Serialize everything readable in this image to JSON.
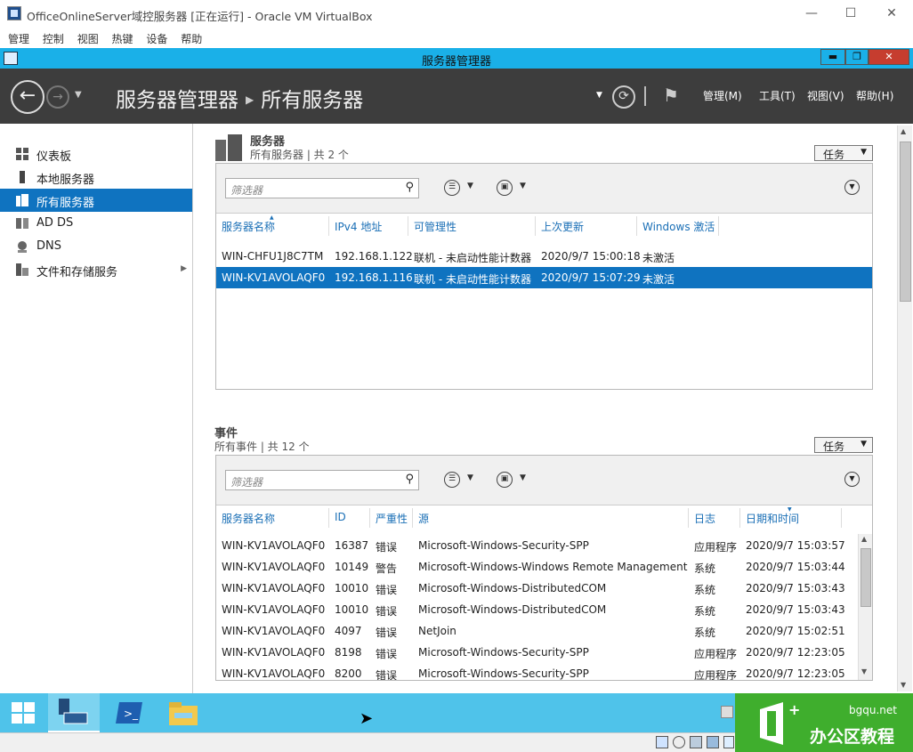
{
  "vbox": {
    "title": "OfficeOnlineServer域控服务器 [正在运行] - Oracle VM VirtualBox",
    "menu": [
      "管理",
      "控制",
      "视图",
      "热键",
      "设备",
      "帮助"
    ]
  },
  "guest_title": "服务器管理器",
  "header": {
    "app": "服务器管理器",
    "page": "所有服务器",
    "menus": [
      "管理(M)",
      "工具(T)",
      "视图(V)",
      "帮助(H)"
    ]
  },
  "nav": {
    "items": [
      {
        "label": "仪表板",
        "icon": "dashboard-icon"
      },
      {
        "label": "本地服务器",
        "icon": "server-icon"
      },
      {
        "label": "所有服务器",
        "icon": "servers-icon",
        "selected": true
      },
      {
        "label": "AD DS",
        "icon": "ad-ds-icon"
      },
      {
        "label": "DNS",
        "icon": "dns-icon"
      },
      {
        "label": "文件和存储服务",
        "icon": "storage-icon",
        "has_arrow": true
      }
    ]
  },
  "servers": {
    "title": "服务器",
    "subtitle": "所有服务器 | 共 2 个",
    "task_label": "任务",
    "filter_placeholder": "筛选器",
    "columns": [
      "服务器名称",
      "IPv4 地址",
      "可管理性",
      "上次更新",
      "Windows 激活"
    ],
    "rows": [
      [
        "WIN-CHFU1J8C7TM",
        "192.168.1.122",
        "联机 - 未启动性能计数器",
        "2020/9/7 15:00:18",
        "未激活"
      ],
      [
        "WIN-KV1AVOLAQF0",
        "192.168.1.116",
        "联机 - 未启动性能计数器",
        "2020/9/7 15:07:29",
        "未激活"
      ]
    ],
    "selected_row": 1
  },
  "events": {
    "title": "事件",
    "subtitle": "所有事件 | 共 12 个",
    "task_label": "任务",
    "filter_placeholder": "筛选器",
    "columns": [
      "服务器名称",
      "ID",
      "严重性",
      "源",
      "日志",
      "日期和时间"
    ],
    "rows": [
      [
        "WIN-KV1AVOLAQF0",
        "16387",
        "错误",
        "Microsoft-Windows-Security-SPP",
        "应用程序",
        "2020/9/7 15:03:57"
      ],
      [
        "WIN-KV1AVOLAQF0",
        "10149",
        "警告",
        "Microsoft-Windows-Windows Remote Management",
        "系统",
        "2020/9/7 15:03:44"
      ],
      [
        "WIN-KV1AVOLAQF0",
        "10010",
        "错误",
        "Microsoft-Windows-DistributedCOM",
        "系统",
        "2020/9/7 15:03:43"
      ],
      [
        "WIN-KV1AVOLAQF0",
        "10010",
        "错误",
        "Microsoft-Windows-DistributedCOM",
        "系统",
        "2020/9/7 15:03:43"
      ],
      [
        "WIN-KV1AVOLAQF0",
        "4097",
        "错误",
        "NetJoin",
        "系统",
        "2020/9/7 15:02:51"
      ],
      [
        "WIN-KV1AVOLAQF0",
        "8198",
        "错误",
        "Microsoft-Windows-Security-SPP",
        "应用程序",
        "2020/9/7 12:23:05"
      ],
      [
        "WIN-KV1AVOLAQF0",
        "8200",
        "错误",
        "Microsoft-Windows-Security-SPP",
        "应用程序",
        "2020/9/7 12:23:05"
      ]
    ]
  },
  "watermark": {
    "site": "bgqu.net",
    "text": "办公区教程"
  },
  "colors": {
    "accent_blue": "#0f73c0",
    "title_cyan": "#1ab0e8",
    "header_dark": "#3d3d3d",
    "taskbar": "#4fc3ea",
    "watermark_green": "#3fae2d"
  }
}
